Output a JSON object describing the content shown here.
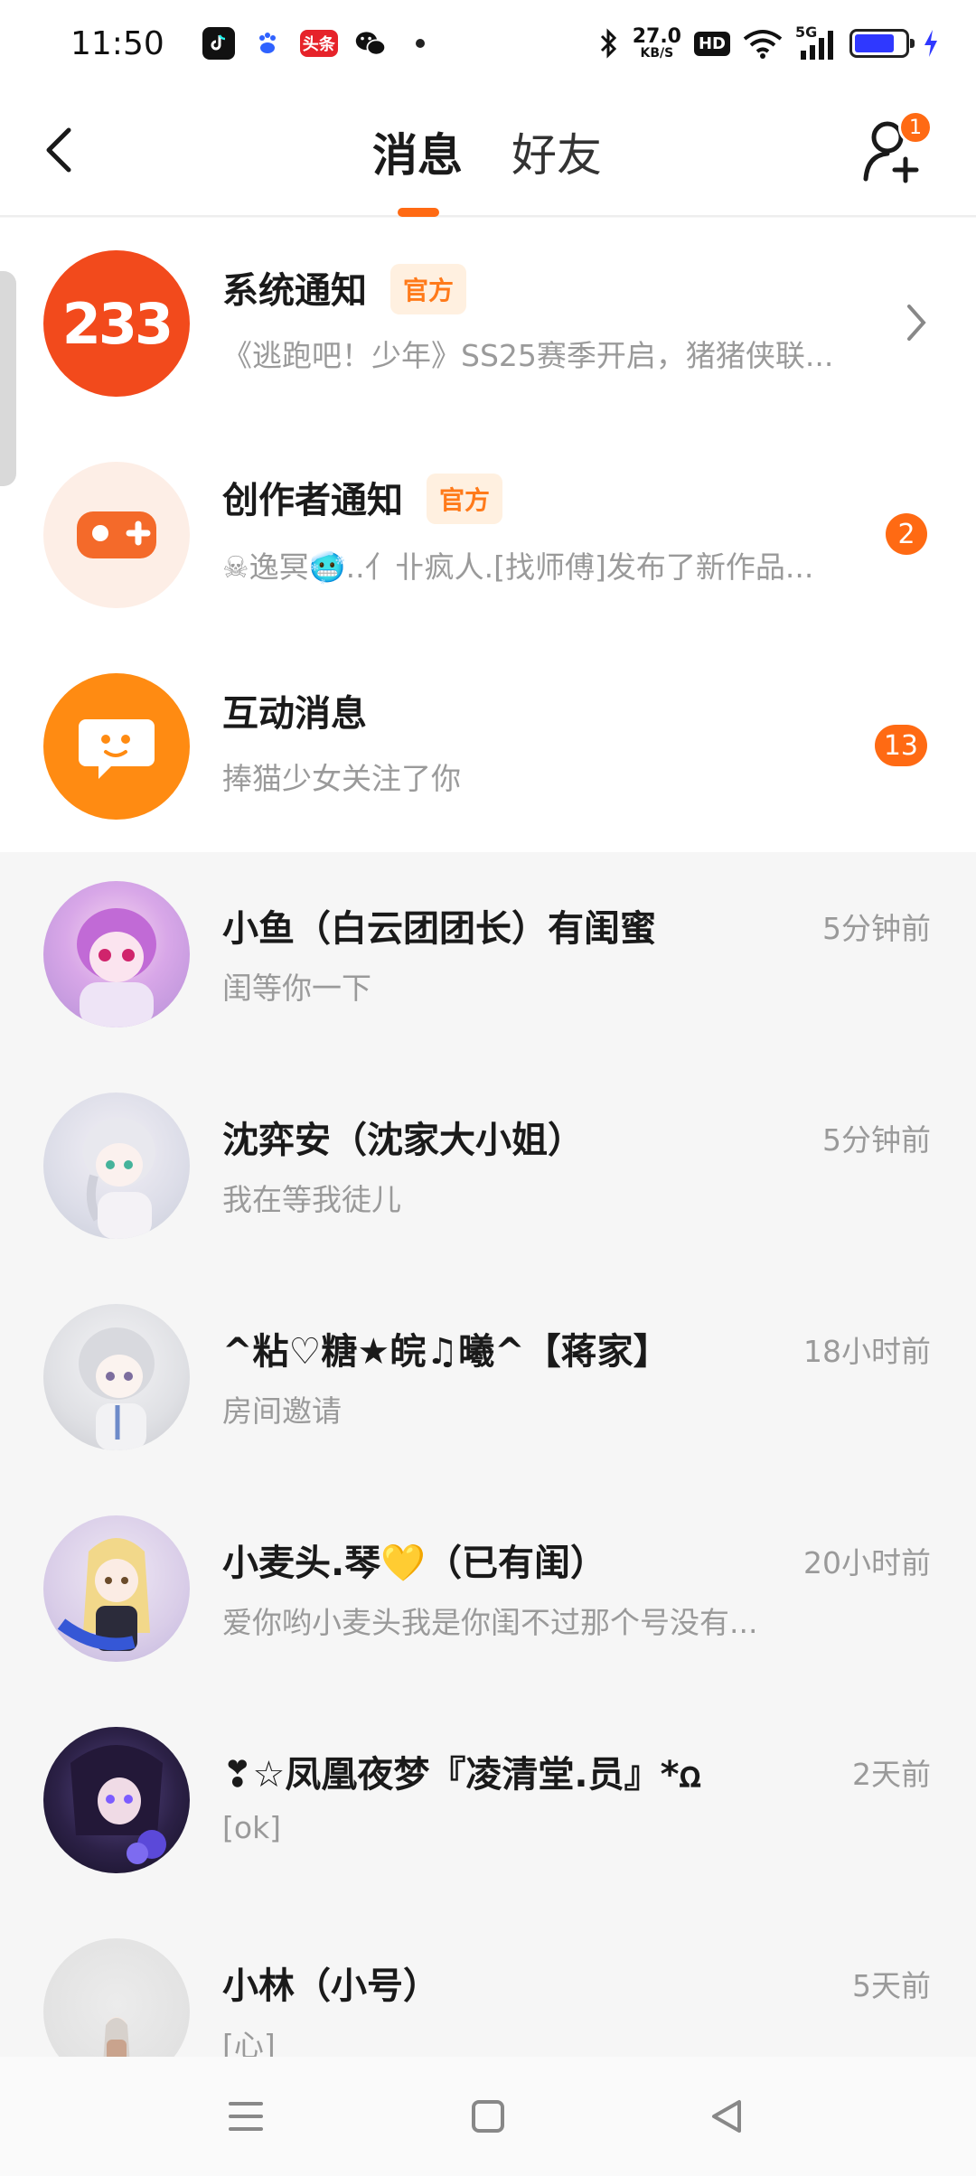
{
  "status_bar": {
    "time": "11:50",
    "apps": [
      "tiktok-icon",
      "baidu-icon",
      "toutiao-icon",
      "wechat-icon"
    ],
    "toutiao_label": "头条",
    "net_speed": "27.0",
    "net_unit": "KB/S",
    "hd_label": "HD",
    "signal_label": "5G",
    "battery_level": 0.8
  },
  "header": {
    "tabs": [
      {
        "label": "消息",
        "active": true
      },
      {
        "label": "好友",
        "active": false
      }
    ],
    "add_friend_badge": "1",
    "accent_color": "#ff6a13"
  },
  "notifications": [
    {
      "title": "系统通知",
      "tag": "官方",
      "subtitle": "《逃跑吧！少年》SS25赛季开启，猪猪侠联...",
      "icon": "233-logo-icon",
      "badge": null
    },
    {
      "title": "创作者通知",
      "tag": "官方",
      "subtitle": "☠逸冥🥶.⁣.亻卝疯人.[找师傅]发布了新作品...",
      "icon": "gamepad-icon",
      "badge": "2"
    },
    {
      "title": "互动消息",
      "tag": null,
      "subtitle": "捧猫少女关注了你",
      "icon": "chat-bubble-icon",
      "badge": "13"
    }
  ],
  "chats": [
    {
      "name": "小鱼（白云团团长）有闺蜜",
      "message": "闺等你一下",
      "time": "5分钟前"
    },
    {
      "name": "沈弈安（沈家大小姐）",
      "message": "我在等我徒儿",
      "time": "5分钟前"
    },
    {
      "name": "^粘♡糖★皖♫曦^【蒋家】",
      "message": "房间邀请",
      "time": "18小时前"
    },
    {
      "name": "小麦头.琴💛（已有闺）",
      "message": "爱你哟小麦头我是你闺不过那个号没有...",
      "time": "20小时前"
    },
    {
      "name": "❣☆凤凰夜梦『凌清堂.员』*ꭥ",
      "message": "[ok]",
      "time": "2天前"
    },
    {
      "name": "小林（小号）",
      "message": "[心]",
      "time": "5天前"
    }
  ],
  "nav_bar": {
    "buttons": [
      "menu-icon",
      "home-icon",
      "back-icon"
    ]
  }
}
